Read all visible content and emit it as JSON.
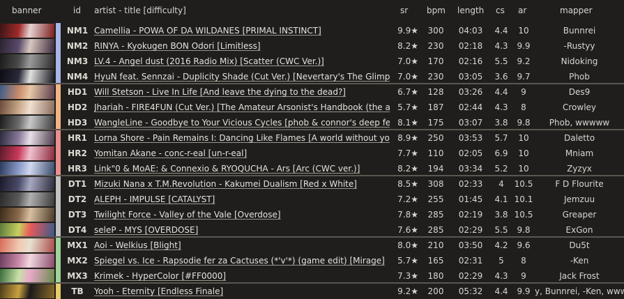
{
  "headers": {
    "banner": "banner",
    "id": "id",
    "title": "artist - title [difficulty]",
    "sr": "sr",
    "bpm": "bpm",
    "length": "length",
    "cs": "cs",
    "ar": "ar",
    "mapper": "mapper"
  },
  "colors": {
    "NM": "#a9b6e8",
    "HD": "#f2b486",
    "HR": "#e98e8e",
    "DT": "#c3c3c3",
    "MX": "#9fd39a",
    "TB": "#e6cc6a"
  },
  "rows": [
    {
      "id": "NM1",
      "group": "NM",
      "title": "Camellia - POWA OF DA WILDANES [PRIMAL INSTINCT]",
      "sr": "9.9★",
      "bpm": "300",
      "length": "04:03",
      "cs": "4.4",
      "ar": "10",
      "mapper": "Bunnrei",
      "banner": [
        "#3a1414",
        "#a02a2a",
        "#e6d2d2",
        "#7a1a1a"
      ]
    },
    {
      "id": "NM2",
      "group": "NM",
      "title": "RINYA - Kyokugen BON Odori [Limitless]",
      "sr": "8.2★",
      "bpm": "230",
      "length": "02:18",
      "cs": "4.3",
      "ar": "9.9",
      "mapper": "-Rustyy",
      "banner": [
        "#2a2230",
        "#5a4a6a",
        "#d8c6c0",
        "#3a2a3a"
      ]
    },
    {
      "id": "NM3",
      "group": "NM",
      "title": "LV.4 - Angel dust (2016 Radio Mix) [Scatter (CWC Ver.)]",
      "sr": "7.0★",
      "bpm": "170",
      "length": "02:16",
      "cs": "5.5",
      "ar": "9.2",
      "mapper": "Nidoking",
      "banner": [
        "#1a1a1a",
        "#4a4a4a",
        "#9a9a9a",
        "#2a2a2a"
      ]
    },
    {
      "id": "NM4",
      "group": "NM",
      "title": "HyuN feat. Sennzai - Duplicity Shade (Cut Ver.) [Nevertary's The Glimpses of Redemption]",
      "sr": "7.0★",
      "bpm": "230",
      "length": "03:05",
      "cs": "3.6",
      "ar": "9.7",
      "mapper": "Phob",
      "banner": [
        "#0c0c14",
        "#2a2a3a",
        "#e0e0e0",
        "#14141c"
      ]
    },
    {
      "id": "HD1",
      "group": "HD",
      "title": "Will Stetson - Live In Life [And leave the dying to the dead?]",
      "sr": "6.7★",
      "bpm": "128",
      "length": "03:26",
      "cs": "4.4",
      "ar": "9",
      "mapper": "Des9",
      "banner": [
        "#3a5a8a",
        "#c88a6a",
        "#e8c8a8",
        "#5a3a4a"
      ]
    },
    {
      "id": "HD2",
      "group": "HD",
      "title": "Jhariah - FIRE4FUN (Cut Ver.) [The Amateur Arsonist's Handbook (the arsonist's lullaby)]",
      "sr": "5.7★",
      "bpm": "187",
      "length": "02:44",
      "cs": "4.3",
      "ar": "8",
      "mapper": "Crowley",
      "banner": [
        "#6a4a3a",
        "#c8a888",
        "#f0e0d0",
        "#8a6a5a"
      ]
    },
    {
      "id": "HD3",
      "group": "HD",
      "title": "WangleLine - Goodbye to Your Vicious Cycles [phob & connor's deep fear]",
      "sr": "8.1★",
      "bpm": "175",
      "length": "03:07",
      "cs": "3.8",
      "ar": "9.8",
      "mapper": "Phob, wwwww",
      "banner": [
        "#1a1a1a",
        "#6a6a6a",
        "#c8c8c8",
        "#3a3a3a"
      ]
    },
    {
      "id": "HR1",
      "group": "HR",
      "title": "Lorna Shore - Pain Remains I: Dancing Like Flames [A world without you is an abyss]",
      "sr": "8.9★",
      "bpm": "250",
      "length": "03:53",
      "cs": "5.7",
      "ar": "10",
      "mapper": "Daletto",
      "banner": [
        "#2a2a3a",
        "#8a7a9a",
        "#e8e0e8",
        "#4a3a4a"
      ]
    },
    {
      "id": "HR2",
      "group": "HR",
      "title": "Yomitan Akane - conc-r-eal [un-r-eal]",
      "sr": "7.7★",
      "bpm": "110",
      "length": "02:05",
      "cs": "6.9",
      "ar": "10",
      "mapper": "Mniam",
      "banner": [
        "#5a1a2a",
        "#c83a5a",
        "#f0c0d0",
        "#8a2a3a"
      ]
    },
    {
      "id": "HR3",
      "group": "HR",
      "title": "Link\"0 & MoAE: & Connexio & RYOQUCHA - Ars [Arc (CWC ver.)]",
      "sr": "8.2★",
      "bpm": "194",
      "length": "03:34",
      "cs": "5.2",
      "ar": "10",
      "mapper": "Zyzyx",
      "banner": [
        "#2a3a5a",
        "#8a9ac8",
        "#d0d8f0",
        "#3a4a6a"
      ]
    },
    {
      "id": "DT1",
      "group": "DT",
      "title": "Mizuki Nana x T.M.Revolution - Kakumei Dualism [Red x White]",
      "sr": "8.5★",
      "bpm": "308",
      "length": "02:33",
      "cs": "4",
      "ar": "10.5",
      "mapper": "F D Flourite",
      "banner": [
        "#1a1a2a",
        "#4a4a6a",
        "#a8a8c0",
        "#2a2a3a"
      ]
    },
    {
      "id": "DT2",
      "group": "DT",
      "title": "ALEPH - IMPULSE [CATALYST]",
      "sr": "7.2★",
      "bpm": "255",
      "length": "01:45",
      "cs": "4.1",
      "ar": "10.1",
      "mapper": "Jemzuu",
      "banner": [
        "#2a2a2a",
        "#5a5a5a",
        "#b0b0b0",
        "#3a3a3a"
      ]
    },
    {
      "id": "DT3",
      "group": "DT",
      "title": "Twilight Force - Valley of the Vale [Overdose]",
      "sr": "7.8★",
      "bpm": "285",
      "length": "02:19",
      "cs": "3.8",
      "ar": "10.5",
      "mapper": "Greaper",
      "banner": [
        "#3a2a1a",
        "#8a6a4a",
        "#d8c0a0",
        "#4a3a2a"
      ]
    },
    {
      "id": "DT4",
      "group": "DT",
      "title": "seleP - MYS [OVERDOSE]",
      "sr": "7.6★",
      "bpm": "285",
      "length": "02:29",
      "cs": "5.5",
      "ar": "9.8",
      "mapper": "ExGon",
      "banner": [
        "#5a7a3a",
        "#c8d060",
        "#e85a5a",
        "#3a5a8a"
      ]
    },
    {
      "id": "MX1",
      "group": "MX",
      "title": "Aoi - Welkius [Blight]",
      "sr": "8.0★",
      "bpm": "210",
      "length": "03:50",
      "cs": "4.2",
      "ar": "9.6",
      "mapper": "Du5t",
      "banner": [
        "#d86a5a",
        "#f0c8b0",
        "#e8e0d0",
        "#a84a4a"
      ]
    },
    {
      "id": "MX2",
      "group": "MX",
      "title": "Spiegel vs. Ice - Rapsodie fer za Cactuses (*'v'*) (game edit) [Mirage]",
      "sr": "5.7★",
      "bpm": "165",
      "length": "02:31",
      "cs": "5",
      "ar": "8",
      "mapper": "-Ken",
      "banner": [
        "#6a3a5a",
        "#c888a8",
        "#f0d8e0",
        "#8a4a6a"
      ]
    },
    {
      "id": "MX3",
      "group": "MX",
      "title": "Krimek - HyperColor [#FF0000]",
      "sr": "7.3★",
      "bpm": "180",
      "length": "02:29",
      "cs": "4.3",
      "ar": "9",
      "mapper": "Jack Frost",
      "banner": [
        "#3a6a3a",
        "#c8e0a8",
        "#e8a8c8",
        "#6a8a4a"
      ]
    },
    {
      "id": "TB",
      "group": "TB",
      "title": "Yooh - Eternity [Endless Finale]",
      "sr": "9.2★",
      "bpm": "200",
      "length": "05:32",
      "cs": "4.4",
      "ar": "9.9",
      "mapper": "y, Bunnrei, -Ken, wwww",
      "banner": [
        "#4a3a1a",
        "#c8a040",
        "#1a1a1a",
        "#8a6a2a"
      ]
    }
  ]
}
